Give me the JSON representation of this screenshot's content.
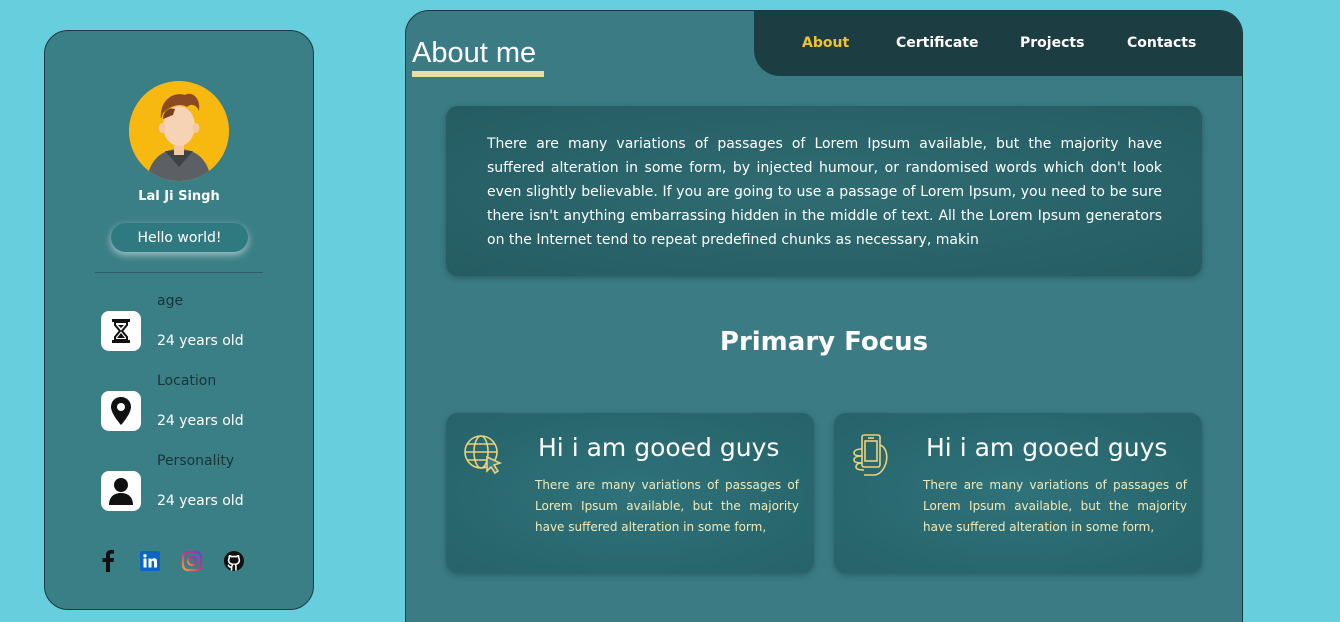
{
  "profile": {
    "name": "Lal Ji Singh",
    "greeting_button": "Hello world!"
  },
  "info": [
    {
      "label": "age",
      "value": "24 years old",
      "icon": "hourglass-icon"
    },
    {
      "label": "Location",
      "value": "24 years old",
      "icon": "location-pin-icon"
    },
    {
      "label": "Personality",
      "value": "24 years old",
      "icon": "person-icon"
    }
  ],
  "socials": [
    "facebook-icon",
    "linkedin-icon",
    "instagram-icon",
    "github-icon"
  ],
  "nav": {
    "items": [
      {
        "label": "About",
        "active": true
      },
      {
        "label": "Certificate",
        "active": false
      },
      {
        "label": "Projects",
        "active": false
      },
      {
        "label": "Contacts",
        "active": false
      }
    ]
  },
  "about": {
    "title": "About me",
    "text": "There are many variations of passages of Lorem Ipsum available, but the majority have suffered alteration in some form, by injected humour, or randomised words which don't look even slightly believable. If you are going to use a passage of Lorem Ipsum, you need to be sure there isn't anything embarrassing hidden in the middle of text. All the Lorem Ipsum generators on the Internet tend to repeat predefined chunks as necessary, makin"
  },
  "focus": {
    "title": "Primary Focus",
    "cards": [
      {
        "heading": "Hi i am gooed guys",
        "text": "There are many variations of passages of Lorem Ipsum available, but the majority have suffered alteration in some form,",
        "icon": "globe-cursor-icon"
      },
      {
        "heading": "Hi i am gooed guys",
        "text": "There are many variations of passages of Lorem Ipsum available, but the majority have suffered alteration in some form,",
        "icon": "smartphone-hand-icon"
      }
    ]
  },
  "colors": {
    "background": "#66cedc",
    "panel": "#3a7b84",
    "nav_bg": "#1c3e42",
    "accent": "#f1c232",
    "underline": "#e3e0a8"
  }
}
